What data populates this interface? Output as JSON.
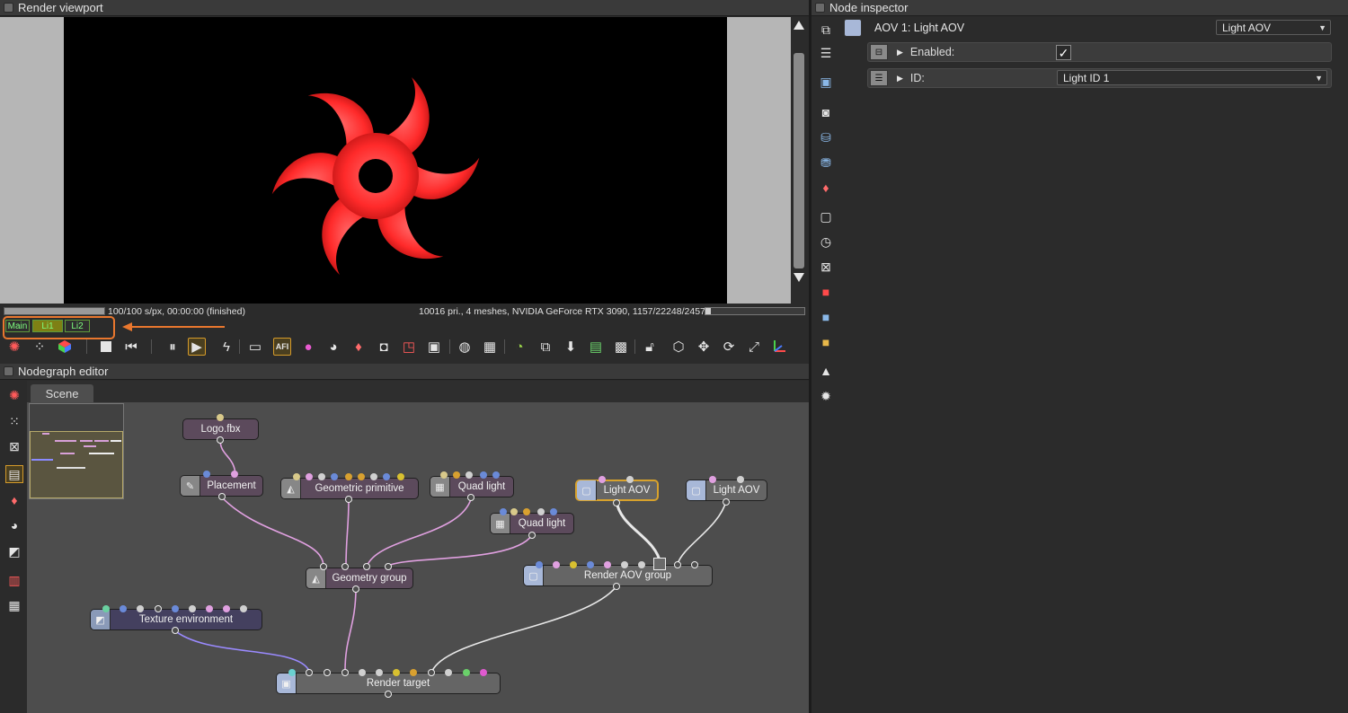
{
  "viewport": {
    "title": "Render viewport",
    "status_left": "100/100 s/px, 00:00:00 (finished)",
    "status_right": "10016 pri., 4 meshes, NVIDIA GeForce RTX 3090, 1157/22248/24576 MB",
    "render_progress": 1.0,
    "memory_usage": 0.05,
    "aov_tabs": [
      "Main",
      "Li1",
      "Li2"
    ],
    "active_aov_tab": "Li1",
    "toolbar_icons": [
      "recenter-icon",
      "region-icon",
      "color-cube-icon",
      "stop-icon",
      "restart-icon",
      "pause-icon",
      "play-icon",
      "lightning-icon",
      "display-icon",
      "afi-icon",
      "color-wheel-icon",
      "material-picker-icon",
      "object-picker-icon",
      "camera-picker-icon",
      "focus-picker-icon",
      "white-balance-icon",
      "world-icon",
      "viewport-resolution-icon",
      "clay-mode-icon",
      "copy-icon",
      "save-icon",
      "export-icon",
      "background-icon",
      "lock-icon",
      "cube-view-icon",
      "move-icon",
      "rotate-icon",
      "scale-icon",
      "axis-gizmo-icon"
    ]
  },
  "nodegraph": {
    "title": "Nodegraph editor",
    "tab": "Scene",
    "nodes": {
      "logo": "Logo.fbx",
      "placement": "Placement",
      "geometric_primitive": "Geometric primitive",
      "quad_light_1": "Quad light",
      "quad_light_2": "Quad light",
      "light_aov_1": "Light AOV",
      "light_aov_2": "Light AOV",
      "geometry_group": "Geometry group",
      "render_aov_group": "Render AOV group",
      "texture_environment": "Texture environment",
      "render_target": "Render target"
    },
    "sidebar_icons": [
      "render-target-icon",
      "node-graph-icon",
      "node-tree-icon",
      "scene-icon",
      "geometry-icon",
      "material-icon",
      "texture-icon",
      "grid-icon",
      "table-icon"
    ]
  },
  "inspector": {
    "title": "Node inspector",
    "header_label": "AOV 1: Light AOV",
    "header_dropdown": "Light AOV",
    "enabled_label": "Enabled:",
    "enabled_checked": true,
    "id_label": "ID:",
    "id_value": "Light ID 1",
    "sidebar_icons": [
      "layers-icon",
      "list-icon",
      "image-icon",
      "camera-icon",
      "database-icon",
      "database-add-icon",
      "shapes-icon",
      "frame-icon",
      "clock-icon",
      "transform-icon",
      "red-cube-icon",
      "blue-cube-icon",
      "yellow-cube-icon",
      "picture-icon",
      "sun-icon"
    ]
  },
  "colors": {
    "accent": "#d8a22c",
    "annotation": "#e9772e",
    "logo_red": "#ff2a2a"
  }
}
